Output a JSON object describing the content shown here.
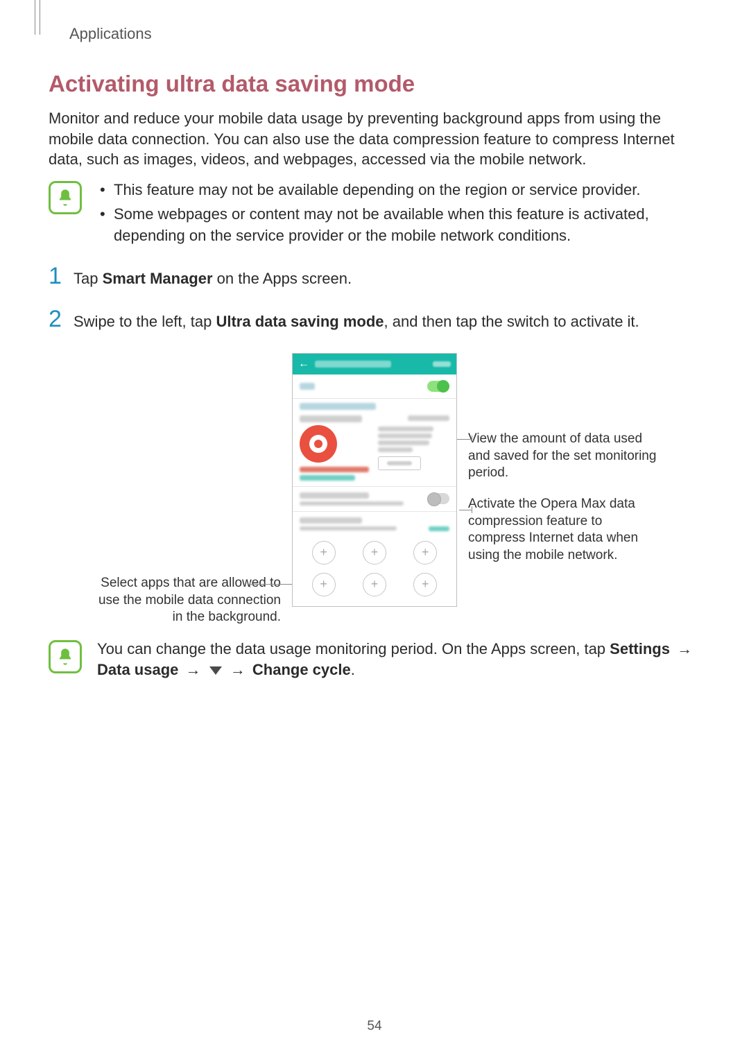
{
  "breadcrumb": "Applications",
  "heading": "Activating ultra data saving mode",
  "intro": "Monitor and reduce your mobile data usage by preventing background apps from using the mobile data connection. You can also use the data compression feature to compress Internet data, such as images, videos, and webpages, accessed via the mobile network.",
  "note1": {
    "items": [
      "This feature may not be available depending on the region or service provider.",
      "Some webpages or content may not be available when this feature is activated, depending on the service provider or the mobile network conditions."
    ]
  },
  "steps": [
    {
      "num": "1",
      "pre": "Tap ",
      "bold": "Smart Manager",
      "post": " on the Apps screen."
    },
    {
      "num": "2",
      "pre": "Swipe to the left, tap ",
      "bold": "Ultra data saving mode",
      "post": ", and then tap the switch to activate it."
    }
  ],
  "callouts": {
    "left": "Select apps that are allowed to use the mobile data connection in the background.",
    "right1": "View the amount of data used and saved for the set monitoring period.",
    "right2": "Activate the Opera Max data compression feature to compress Internet data when using the mobile network."
  },
  "note2": {
    "pre": "You can change the data usage monitoring period. On the Apps screen, tap ",
    "b1": "Settings",
    "arrow": "→",
    "b2": "Data usage",
    "b3": "Change cycle",
    "suffix": "."
  },
  "page_number": "54"
}
